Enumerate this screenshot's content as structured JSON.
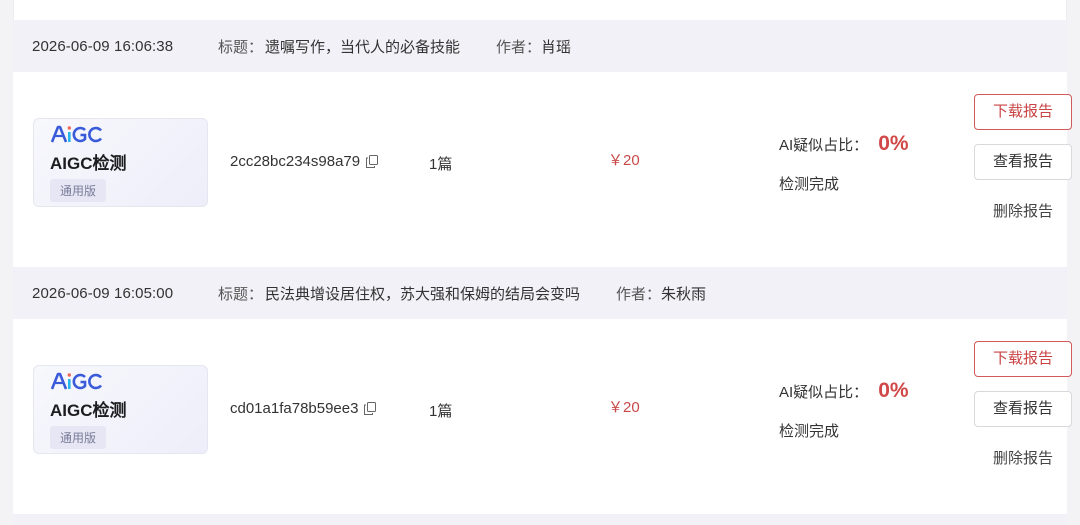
{
  "orders": [
    {
      "time": "2026-06-09 16:06:38",
      "title_label": "标题：",
      "title": "遗嘱写作，当代人的必备技能",
      "author_label": "作者：",
      "author": "肖瑶",
      "product": {
        "logo": "AiGC",
        "name": "AIGC检测",
        "edition": "通用版"
      },
      "order_id": "2cc28bc234s98a79",
      "quantity": "1篇",
      "price": "￥20",
      "ai_ratio_label": "AI疑似占比：",
      "ai_ratio_value": "0%",
      "status": "检测完成",
      "buttons": {
        "download": "下载报告",
        "view": "查看报告",
        "delete": "删除报告"
      }
    },
    {
      "time": "2026-06-09 16:05:00",
      "title_label": "标题：",
      "title": "民法典增设居住权，苏大强和保姆的结局会变吗",
      "author_label": "作者：",
      "author": "朱秋雨",
      "product": {
        "logo": "AiGC",
        "name": "AIGC检测",
        "edition": "通用版"
      },
      "order_id": "cd01a1fa78b59ee3",
      "quantity": "1篇",
      "price": "￥20",
      "ai_ratio_label": "AI疑似占比：",
      "ai_ratio_value": "0%",
      "status": "检测完成",
      "buttons": {
        "download": "下载报告",
        "view": "查看报告",
        "delete": "删除报告"
      }
    }
  ],
  "colors": {
    "accent_red": "#c94545",
    "header_bg": "#f1f1f7",
    "logo_blue": "#3a5bd9",
    "logo_cyan": "#27b6e8"
  },
  "icons": [
    "copy-icon"
  ]
}
